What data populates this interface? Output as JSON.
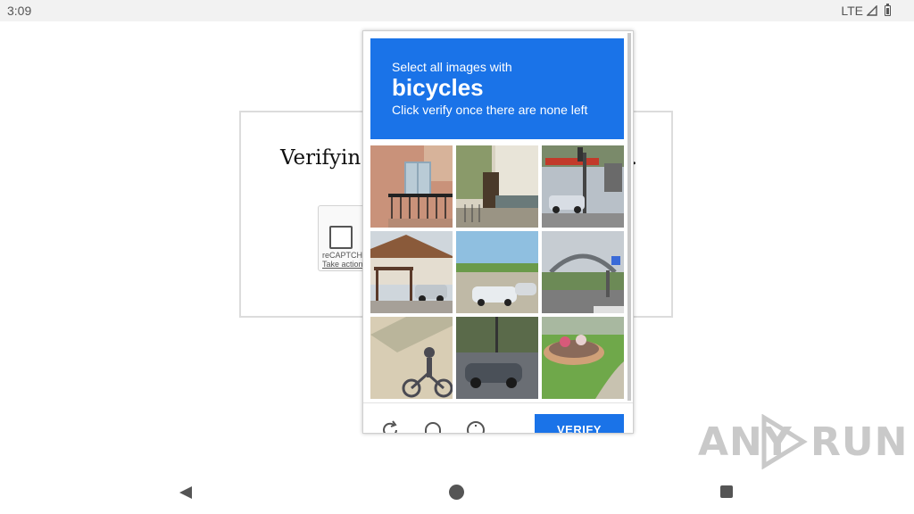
{
  "status_bar": {
    "time": "3:09",
    "network": "LTE"
  },
  "background_page": {
    "title_partial": "Verifyin",
    "title_trailing": ".",
    "recaptcha_label": "reCAPTCHA",
    "take_action_label": "Take action"
  },
  "challenge": {
    "instruction_top": "Select all images with",
    "target_object": "bicycles",
    "instruction_bottom": "Click verify once there are none left",
    "tiles": [
      {
        "id": 1,
        "scene": "building with balcony"
      },
      {
        "id": 2,
        "scene": "house entrance with fence"
      },
      {
        "id": 3,
        "scene": "gas station with car"
      },
      {
        "id": 4,
        "scene": "house with pergola and car"
      },
      {
        "id": 5,
        "scene": "field with parked cars"
      },
      {
        "id": 6,
        "scene": "road with bridge"
      },
      {
        "id": 7,
        "scene": "shadow of bicycle on sand"
      },
      {
        "id": 8,
        "scene": "car on road"
      },
      {
        "id": 9,
        "scene": "flower bed on grass"
      }
    ],
    "footer": {
      "reload_icon": "reload-icon",
      "audio_icon": "headphones-icon",
      "info_icon": "info-icon",
      "verify_label": "VERIFY"
    },
    "accent_color": "#1a73e8"
  },
  "watermark": {
    "text_left": "ANY",
    "text_right": "RUN"
  },
  "nav_bar": {
    "back_icon": "back-icon",
    "home_icon": "home-icon",
    "recent_icon": "recent-apps-icon"
  }
}
